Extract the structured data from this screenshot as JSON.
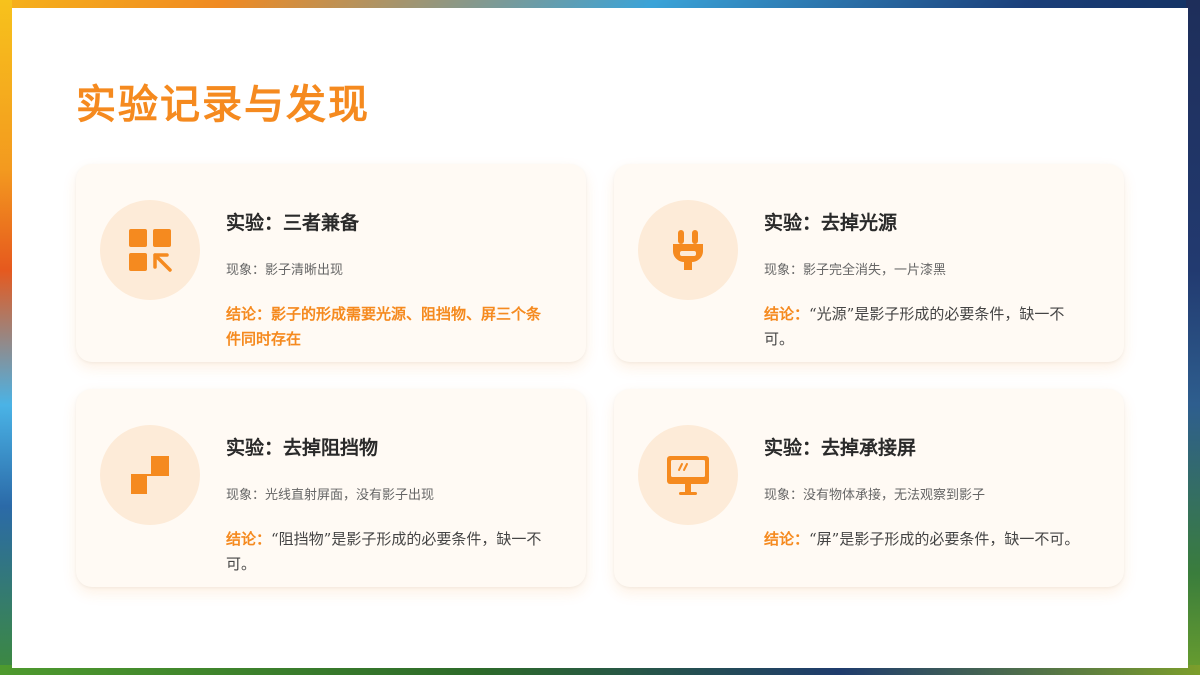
{
  "colors": {
    "accent": "#f58a1f",
    "icon_bg": "#fdebd8",
    "card_bg": "#fffaf4",
    "text_dark": "#2a2a2a"
  },
  "page": {
    "title": "实验记录与发现"
  },
  "cards": [
    {
      "icon": "grid-arrow-icon",
      "title": "实验：三者兼备",
      "phenomenon": "现象：影子清晰出现",
      "conclusion_label": "结论：",
      "conclusion_text": "影子的形成需要光源、阻挡物、屏三个条件同时存在"
    },
    {
      "icon": "plug-icon",
      "title": "实验：去掉光源",
      "phenomenon": "现象：影子完全消失，一片漆黑",
      "conclusion_label": "结论：",
      "conclusion_text": "“光源”是影子形成的必要条件，缺一不可。"
    },
    {
      "icon": "block-steps-icon",
      "title": "实验：去掉阻挡物",
      "phenomenon": "现象：光线直射屏面，没有影子出现",
      "conclusion_label": "结论：",
      "conclusion_text": "“阻挡物”是影子形成的必要条件，缺一不可。"
    },
    {
      "icon": "monitor-icon",
      "title": "实验：去掉承接屏",
      "phenomenon": "现象：没有物体承接，无法观察到影子",
      "conclusion_label": "结论：",
      "conclusion_text": "“屏”是影子形成的必要条件，缺一不可。"
    }
  ]
}
